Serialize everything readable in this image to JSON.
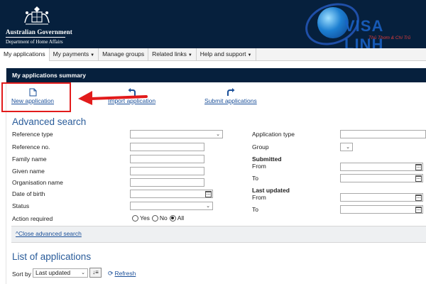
{
  "header": {
    "gov_line1": "Australian Government",
    "gov_line2": "Department of Home Affairs",
    "logo_brand": "VISA LINH",
    "logo_slogan": "Thủ Thơm & Chí Trũ"
  },
  "nav": {
    "items": [
      {
        "label": "My applications",
        "active": true,
        "caret": false
      },
      {
        "label": "My payments",
        "caret": true
      },
      {
        "label": "Manage groups",
        "caret": false
      },
      {
        "label": "Related links",
        "caret": true
      },
      {
        "label": "Help and support",
        "caret": true
      }
    ]
  },
  "summary": {
    "title": "My applications summary",
    "actions": {
      "new": "New application",
      "import": "Import application",
      "submit": "Submit applications"
    }
  },
  "search": {
    "title": "Advanced search",
    "left": {
      "reference_type": "Reference type",
      "reference_no": "Reference no.",
      "family_name": "Family name",
      "given_name": "Given name",
      "organisation_name": "Organisation name",
      "date_of_birth": "Date of birth",
      "status": "Status",
      "action_required": "Action required"
    },
    "radio": {
      "yes": "Yes",
      "no": "No",
      "all": "All",
      "selected": "All"
    },
    "right": {
      "application_type": "Application type",
      "group": "Group",
      "submitted": "Submitted",
      "last_updated": "Last updated",
      "from": "From",
      "to": "To"
    },
    "close": "Close advanced search",
    "close_prefix": "^"
  },
  "list": {
    "title": "List of applications",
    "sort_by": "Sort by",
    "sort_value": "Last updated",
    "refresh": "Refresh"
  },
  "colors": {
    "header_bg": "#06203d",
    "link": "#1a4f99",
    "section_title": "#2a5c9a",
    "highlight": "#e21b1b"
  }
}
